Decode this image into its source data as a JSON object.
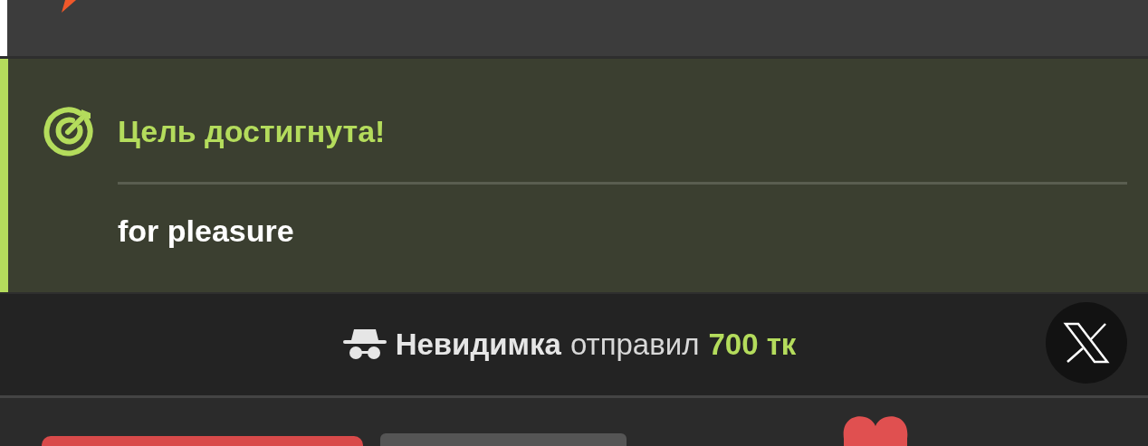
{
  "goal": {
    "title": "Цель достигнута!",
    "description": "for pleasure"
  },
  "donation": {
    "sender": "Невидимка",
    "action": "отправил",
    "amount": "700 тк"
  }
}
